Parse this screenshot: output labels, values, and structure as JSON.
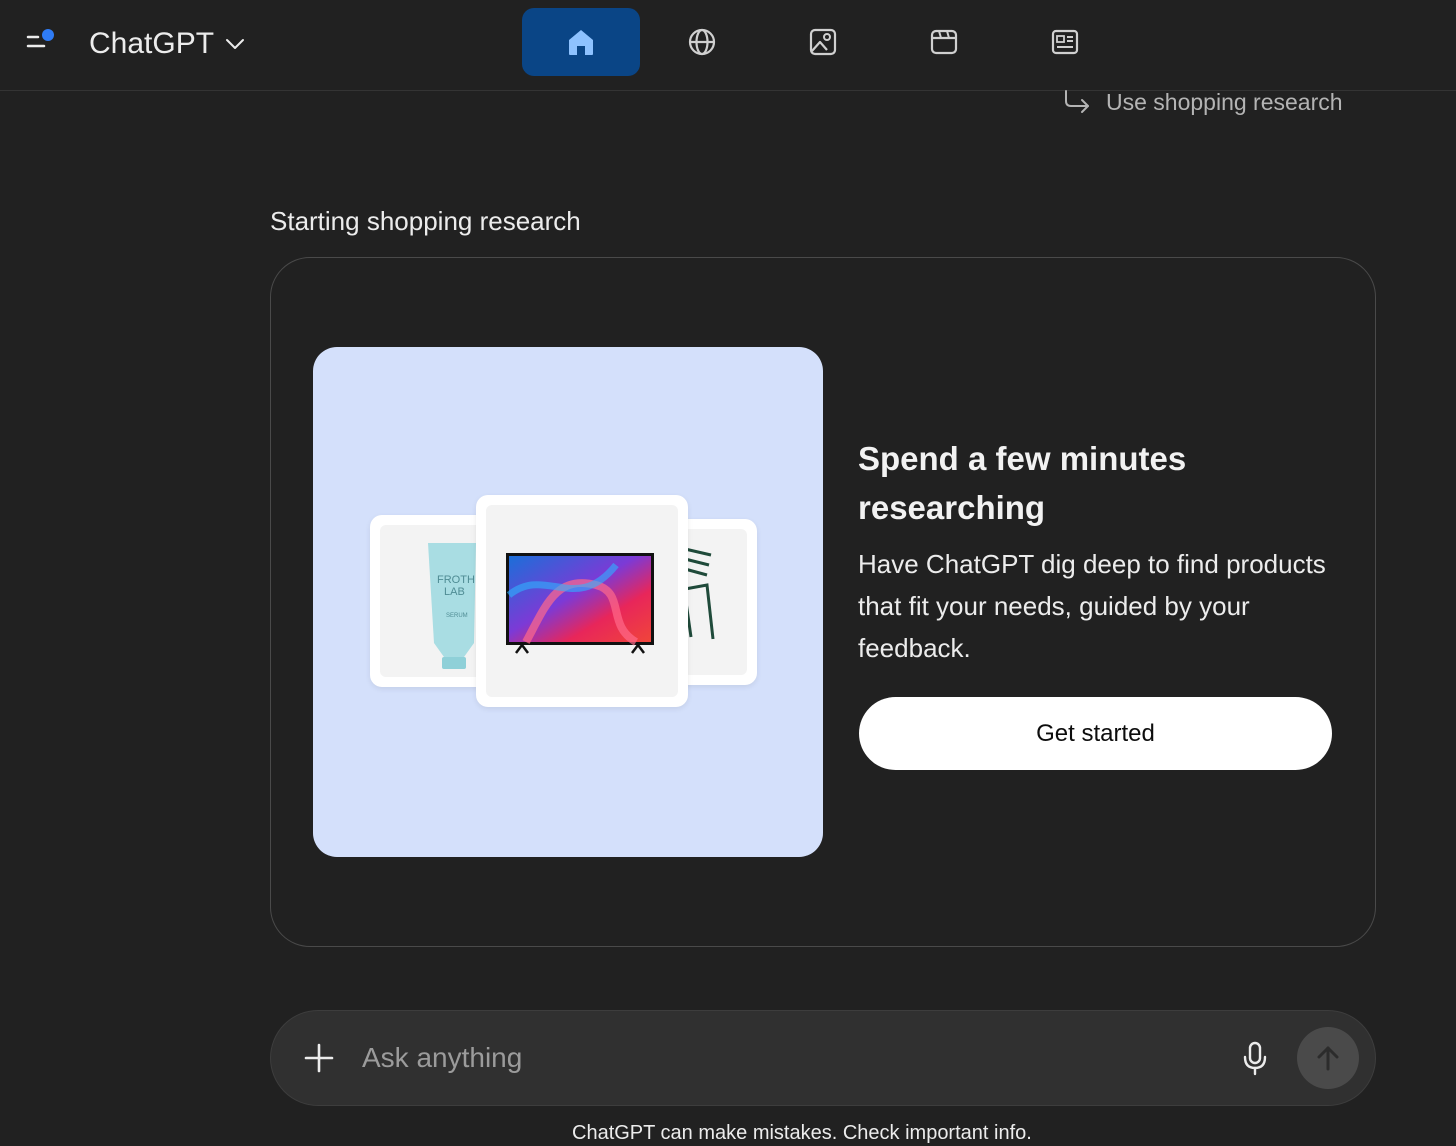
{
  "header": {
    "app_title": "ChatGPT",
    "tabs": [
      {
        "icon": "home-icon",
        "active": true
      },
      {
        "icon": "globe-icon",
        "active": false
      },
      {
        "icon": "image-icon",
        "active": false
      },
      {
        "icon": "video-icon",
        "active": false
      },
      {
        "icon": "news-icon",
        "active": false
      }
    ],
    "accent_color": "#0a4586",
    "notification_dot_color": "#2f7cf6"
  },
  "thread": {
    "use_tool_label": "Use shopping research",
    "status_label": "Starting shopping research"
  },
  "card": {
    "title": "Spend a few minutes researching",
    "description": "Have ChatGPT dig deep to find products that fit your needs, guided by your feedback.",
    "cta_label": "Get started",
    "illustration": {
      "background": "#d4e0fb",
      "products": [
        {
          "name": "serum-tube",
          "brand_text": "FROTH LAB",
          "sub_text": "SERUM"
        },
        {
          "name": "television"
        },
        {
          "name": "green-chair"
        }
      ]
    }
  },
  "composer": {
    "placeholder": "Ask anything"
  },
  "footer": {
    "disclaimer": "ChatGPT can make mistakes. Check important info."
  }
}
